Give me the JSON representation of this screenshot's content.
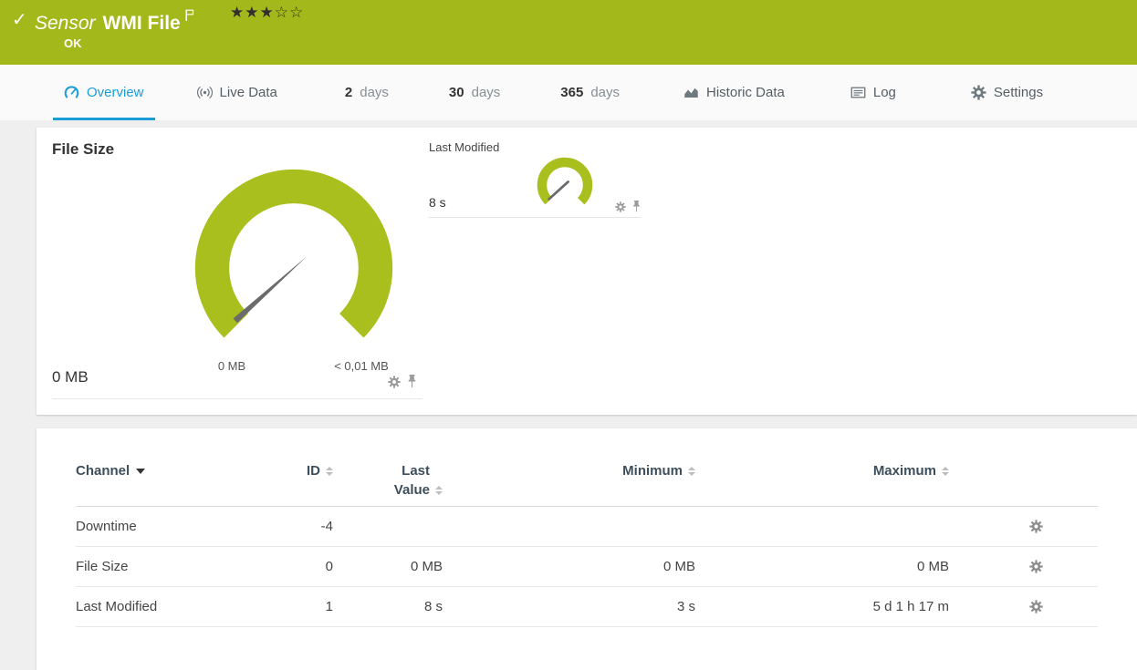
{
  "header": {
    "kind_label": "Sensor",
    "title": "WMI File",
    "status": "OK",
    "stars": "★★★☆☆"
  },
  "tabs": [
    {
      "label": "Overview"
    },
    {
      "label": "Live Data"
    },
    {
      "num": "2",
      "label": "days"
    },
    {
      "num": "30",
      "label": "days"
    },
    {
      "num": "365",
      "label": "days"
    },
    {
      "label": "Historic Data"
    },
    {
      "label": "Log"
    },
    {
      "label": "Settings"
    }
  ],
  "gauges": {
    "file_size": {
      "title": "File Size",
      "min_label": "0 MB",
      "max_label": "< 0,01 MB",
      "value": "0 MB"
    },
    "last_modified": {
      "title": "Last Modified",
      "value": "8 s"
    }
  },
  "channels": {
    "columns": [
      "Channel",
      "ID",
      "Last Value",
      "Minimum",
      "Maximum"
    ],
    "rows": [
      {
        "channel": "Downtime",
        "id": "-4",
        "last": "",
        "min": "",
        "max": ""
      },
      {
        "channel": "File Size",
        "id": "0",
        "last": "0 MB",
        "min": "0 MB",
        "max": "0 MB"
      },
      {
        "channel": "Last Modified",
        "id": "1",
        "last": "8 s",
        "min": "3 s",
        "max": "5 d 1 h 17 m"
      }
    ]
  },
  "colors": {
    "header_green": "#a3b81a",
    "gauge_green": "#a9bf1d",
    "accent_blue": "#1a9cd8"
  }
}
